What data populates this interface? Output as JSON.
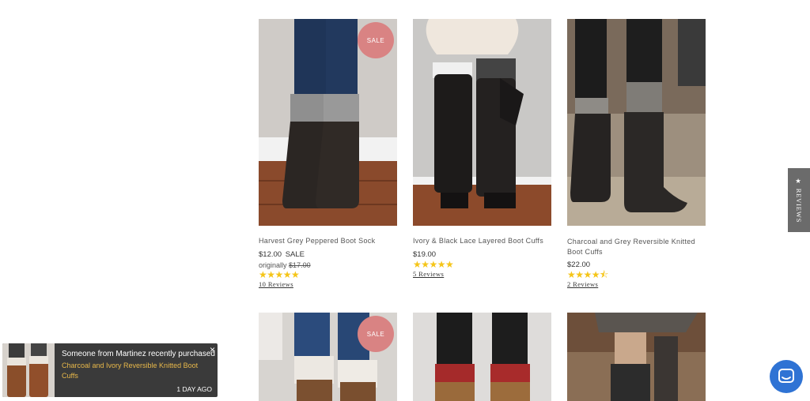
{
  "products": [
    {
      "title": "Harvest Grey Peppered Boot Sock",
      "price": "$12.00",
      "sale_word": "SALE",
      "originally_label": "originally",
      "original_price": "$17.00",
      "badge": "SALE",
      "rating": 5,
      "stars": "★★★★★",
      "reviews": "10 Reviews"
    },
    {
      "title": "Ivory & Black Lace Layered Boot Cuffs",
      "price": "$19.00",
      "rating": 5,
      "stars": "★★★★★",
      "reviews": "5 Reviews"
    },
    {
      "title": "Charcoal and Grey Reversible Knitted Boot Cuffs",
      "price": "$22.00",
      "rating": 4.5,
      "stars": "★★★★⯪",
      "reviews": "2 Reviews"
    },
    {
      "badge": "SALE"
    },
    {},
    {}
  ],
  "reviews_tab": {
    "label": "★ REVIEWS"
  },
  "popup": {
    "headline": "Someone from Martinez recently purchased",
    "product": "Charcoal and Ivory Reversible Knitted Boot Cuffs",
    "time": "1 DAY AGO",
    "close": "×"
  },
  "colors": {
    "sale_badge": "#d98383",
    "stars": "#f5c518",
    "popup_bg": "#3a3a3a",
    "popup_product": "#e8b84a",
    "chat": "#2f73d4"
  },
  "icons": {
    "chat": "chat-bubble-icon",
    "close": "close-icon",
    "star": "star-icon"
  }
}
